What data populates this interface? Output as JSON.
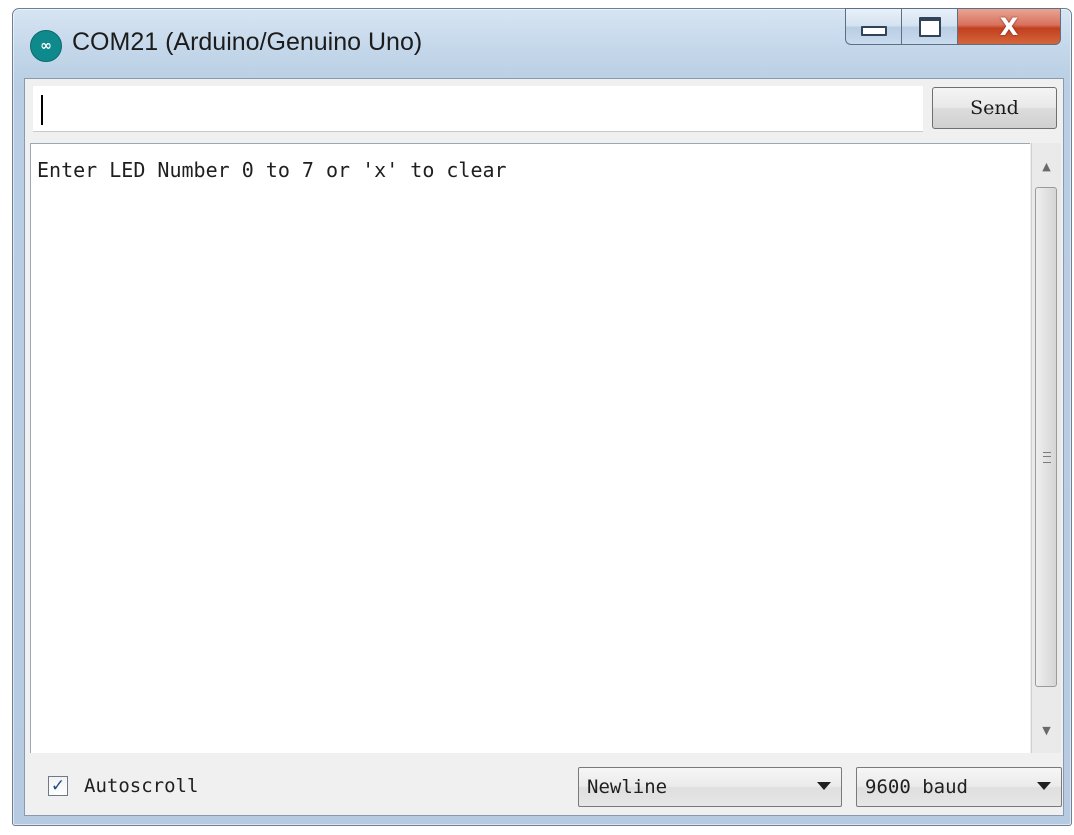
{
  "window": {
    "title": "COM21 (Arduino/Genuino Uno)",
    "close_glyph": "X"
  },
  "send": {
    "input_value": "",
    "button_label": "Send"
  },
  "output": {
    "lines": [
      "Enter LED Number 0 to 7 or 'x' to clear"
    ]
  },
  "footer": {
    "autoscroll_label": "Autoscroll",
    "autoscroll_checked": true,
    "line_ending": "Newline",
    "baud_rate": "9600 baud"
  },
  "colors": {
    "arduino_teal": "#0f8a8c",
    "close_red": "#c1401f"
  },
  "icons": [
    "arduino-logo-icon",
    "minimize-icon",
    "maximize-icon",
    "close-icon",
    "scroll-up-icon",
    "scroll-down-icon",
    "checkmark-icon",
    "dropdown-arrow-icon"
  ]
}
